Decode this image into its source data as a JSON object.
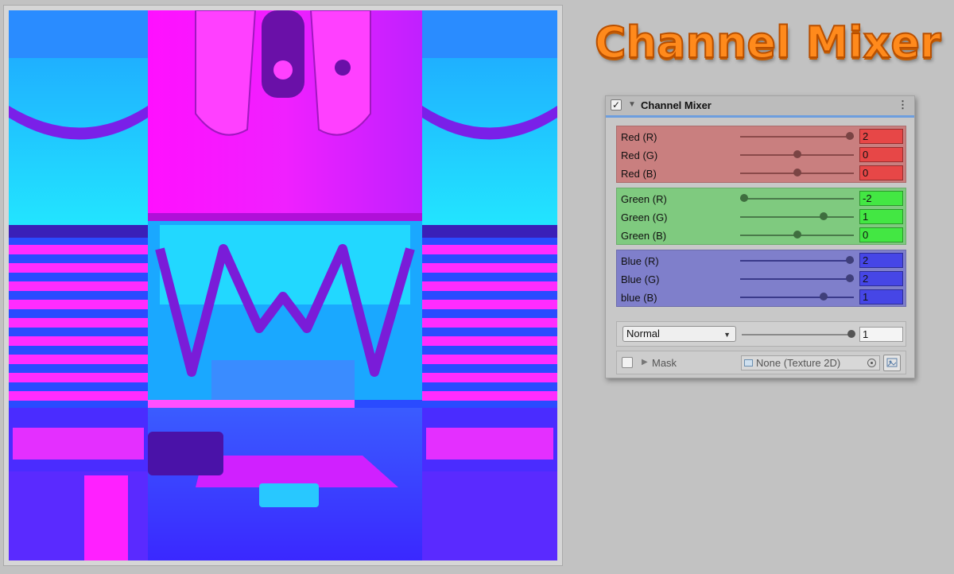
{
  "title": "Channel Mixer",
  "colors": {
    "red_group": "#c97f7f",
    "green_group": "#7fca7f",
    "blue_group": "#7f7fcb",
    "red_field": "#e74747",
    "green_field": "#43e743",
    "blue_field": "#4646e6",
    "accent": "#6d9ede"
  },
  "inspector": {
    "component_name": "Channel Mixer",
    "enabled_glyph": "✓",
    "foldout_glyph": "▼",
    "menu_glyph": "⋮",
    "slider_min": -2,
    "slider_max": 2,
    "groups": [
      {
        "key": "red",
        "rows": [
          {
            "label": "Red (R)",
            "value": "2"
          },
          {
            "label": "Red (G)",
            "value": "0"
          },
          {
            "label": "Red (B)",
            "value": "0"
          }
        ]
      },
      {
        "key": "green",
        "rows": [
          {
            "label": "Green (R)",
            "value": "-2"
          },
          {
            "label": "Green (G)",
            "value": "1"
          },
          {
            "label": "Green (B)",
            "value": "0"
          }
        ]
      },
      {
        "key": "blue",
        "rows": [
          {
            "label": "Blue (R)",
            "value": "2"
          },
          {
            "label": "Blue (G)",
            "value": "2"
          },
          {
            "label": "blue (B)",
            "value": "1"
          }
        ]
      }
    ],
    "blend": {
      "mode": "Normal",
      "arrow_glyph": "▼",
      "opacity": "1",
      "opacity_fraction": 1
    },
    "mask": {
      "foldout_glyph": "▶",
      "label": "Mask",
      "texture": "None (Texture 2D)"
    }
  }
}
